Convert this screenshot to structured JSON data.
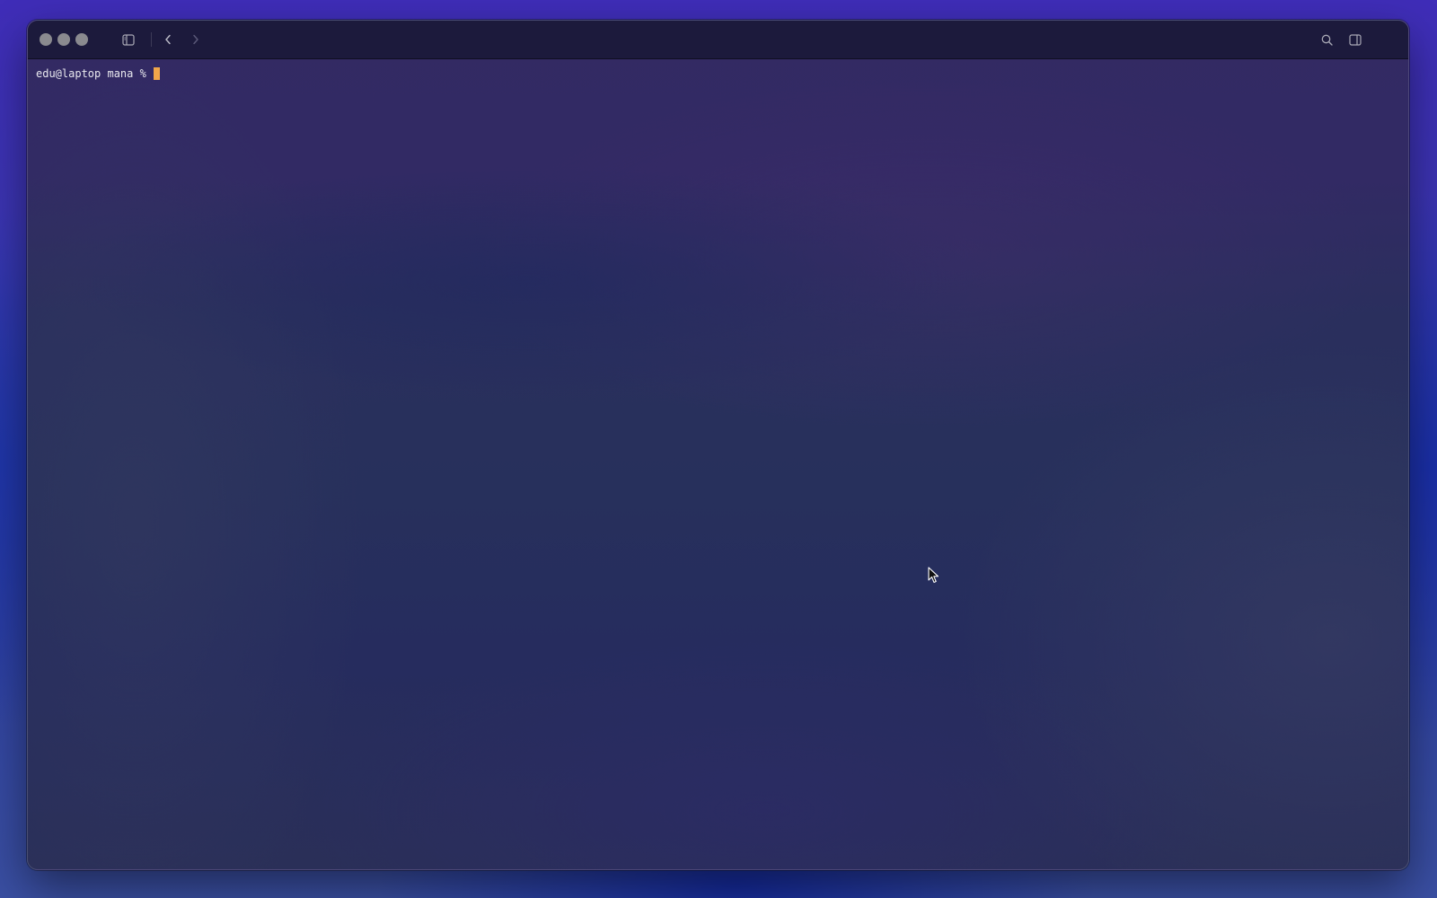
{
  "window": {
    "traffic_lights": [
      "close",
      "minimize",
      "zoom"
    ],
    "toolbar_left_icons": [
      "sidebar-toggle-icon",
      "back-chevron-icon",
      "forward-chevron-icon"
    ],
    "toolbar_right_icons": [
      "search-icon",
      "right-sidebar-icon"
    ]
  },
  "terminal": {
    "prompt": "edu@laptop mana % ",
    "cursor_color": "#f0a64a"
  },
  "colors": {
    "titlebar": "#1c1a3c",
    "terminal_text": "#e8e8ee",
    "traffic_light": "#8a8a8f"
  }
}
